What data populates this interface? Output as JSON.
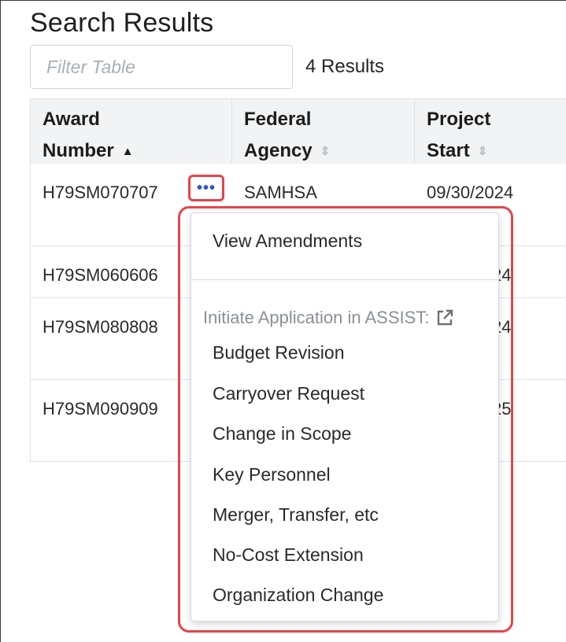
{
  "page": {
    "title": "Search Results",
    "filter_placeholder": "Filter Table",
    "results_count": "4 Results"
  },
  "table": {
    "columns": [
      {
        "line1": "Award",
        "line2": "Number",
        "sort": "ascending"
      },
      {
        "line1": "Federal",
        "line2": "Agency",
        "sort": "none"
      },
      {
        "line1": "Project",
        "line2": "Start",
        "sort": "none"
      }
    ],
    "rows": [
      {
        "award_number": "H79SM070707",
        "agency": "SAMHSA",
        "project_start": "09/30/2024"
      },
      {
        "award_number": "H79SM060606",
        "agency": "",
        "project_start_partial": "24"
      },
      {
        "award_number": "H79SM080808",
        "agency": "",
        "project_start_partial": "24"
      },
      {
        "award_number": "H79SM090909",
        "agency": "",
        "project_start_partial": "25"
      }
    ],
    "more_actions_glyph": "•••"
  },
  "dropdown": {
    "view_amendments": "View Amendments",
    "section_header": "Initiate Application in ASSIST:",
    "items": [
      "Budget Revision",
      "Carryover Request",
      "Change in Scope",
      "Key Personnel",
      "Merger, Transfer, etc",
      "No-Cost Extension",
      "Organization Change"
    ]
  },
  "colors": {
    "highlight": "#e8434b",
    "link": "#2f55c8",
    "header_bg": "#f2f3f5"
  },
  "icons": {
    "sort_ascending": "caret-up-icon",
    "sort_unsorted": "sort-both-icon",
    "external_link": "external-link-icon",
    "more_actions": "ellipsis-icon"
  }
}
